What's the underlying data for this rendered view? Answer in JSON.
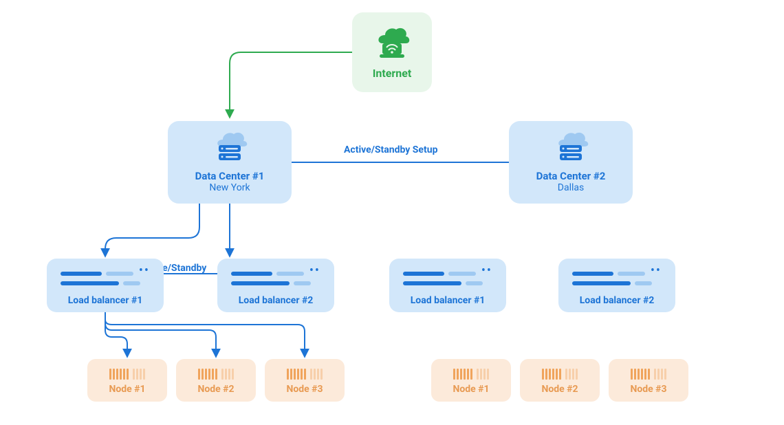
{
  "internet": {
    "label": "Internet"
  },
  "datacenters": {
    "dc1": {
      "title": "Data Center #1",
      "location": "New York"
    },
    "dc2": {
      "title": "Data Center #2",
      "location": "Dallas"
    }
  },
  "captions": {
    "active_standby_setup": "Active/Standby Setup",
    "active_standby": "Active/Standby"
  },
  "load_balancers": {
    "lb1": {
      "label": "Load balancer #1"
    },
    "lb2": {
      "label": "Load balancer #2"
    },
    "lb3": {
      "label": "Load balancer #1"
    },
    "lb4": {
      "label": "Load balancer #2"
    }
  },
  "nodes": {
    "a1": {
      "label": "Node #1"
    },
    "a2": {
      "label": "Node #2"
    },
    "a3": {
      "label": "Node #3"
    },
    "b1": {
      "label": "Node #1"
    },
    "b2": {
      "label": "Node #2"
    },
    "b3": {
      "label": "Node #3"
    }
  },
  "colors": {
    "green": "#2EAA4F",
    "blue": "#1D74D6",
    "blue_lt": "#9FC9F1",
    "orange": "#F0A45C"
  }
}
